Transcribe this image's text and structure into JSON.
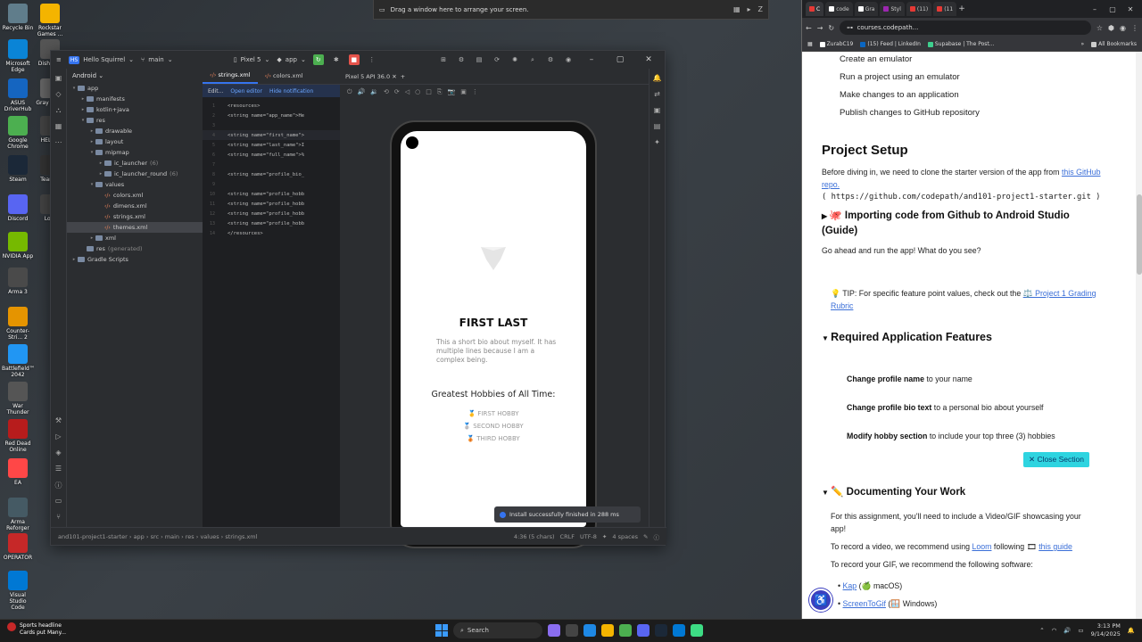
{
  "desktop": {
    "icons": [
      {
        "label": "Recycle Bin",
        "color": "#607d8b"
      },
      {
        "label": "Rockstar Games ...",
        "color": "#f4b400"
      },
      {
        "label": "Microsoft Edge",
        "color": "#0a84d6"
      },
      {
        "label": "Dishon...",
        "color": "#555555"
      },
      {
        "label": "ASUS DriverHub",
        "color": "#1565c0"
      },
      {
        "label": "Gray Wa...",
        "color": "#666666"
      },
      {
        "label": "Google Chrome",
        "color": "#4caf50"
      },
      {
        "label": "HELL...",
        "color": "#444444"
      },
      {
        "label": "Steam",
        "color": "#1b2838"
      },
      {
        "label": "Team...",
        "color": "#333333"
      },
      {
        "label": "Discord",
        "color": "#5865f2"
      },
      {
        "label": "Lo...",
        "color": "#444444"
      },
      {
        "label": "NVIDIA App",
        "color": "#76b900"
      },
      {
        "label": "Arma 3",
        "color": "#4a4a4a"
      },
      {
        "label": "Counter-Stri... 2",
        "color": "#e59400"
      },
      {
        "label": "Battlefield™ 2042",
        "color": "#2196f3"
      },
      {
        "label": "War Thunder",
        "color": "#555555"
      },
      {
        "label": "Red Dead Online",
        "color": "#b71c1c"
      },
      {
        "label": "EA",
        "color": "#ff4747"
      },
      {
        "label": "Arma Reforger",
        "color": "#455a64"
      },
      {
        "label": "OPERATOR",
        "color": "#c62828"
      },
      {
        "label": "Visual Studio Code",
        "color": "#0078d4"
      }
    ]
  },
  "snap_bar": {
    "text": "Drag a window here to arrange your screen.",
    "controls": [
      "▦",
      "▸",
      "Z"
    ]
  },
  "android_studio": {
    "project_badge": "HS",
    "project_name": "Hello Squirrel",
    "branch": "main",
    "device": "Pixel 5",
    "run_config": "app",
    "project_view": "Android",
    "tree": [
      {
        "label": "app",
        "indent": 0,
        "kind": "folder",
        "arrow": "▾"
      },
      {
        "label": "manifests",
        "indent": 1,
        "kind": "folder",
        "arrow": "▸"
      },
      {
        "label": "kotlin+java",
        "indent": 1,
        "kind": "folder",
        "arrow": "▸"
      },
      {
        "label": "res",
        "indent": 1,
        "kind": "folder",
        "arrow": "▾"
      },
      {
        "label": "drawable",
        "indent": 2,
        "kind": "folder",
        "arrow": "▸"
      },
      {
        "label": "layout",
        "indent": 2,
        "kind": "folder",
        "arrow": "▸"
      },
      {
        "label": "mipmap",
        "indent": 2,
        "kind": "folder",
        "arrow": "▾"
      },
      {
        "label": "ic_launcher",
        "indent": 3,
        "kind": "folder",
        "arrow": "▸",
        "extra": "(6)"
      },
      {
        "label": "ic_launcher_round",
        "indent": 3,
        "kind": "folder",
        "arrow": "▸",
        "extra": "(6)"
      },
      {
        "label": "values",
        "indent": 2,
        "kind": "folder",
        "arrow": "▾"
      },
      {
        "label": "colors.xml",
        "indent": 3,
        "kind": "xml",
        "arrow": ""
      },
      {
        "label": "dimens.xml",
        "indent": 3,
        "kind": "xml",
        "arrow": ""
      },
      {
        "label": "strings.xml",
        "indent": 3,
        "kind": "xml",
        "arrow": ""
      },
      {
        "label": "themes.xml",
        "indent": 3,
        "kind": "xml",
        "arrow": "",
        "selected": true
      },
      {
        "label": "xml",
        "indent": 2,
        "kind": "folder",
        "arrow": "▸"
      },
      {
        "label": "res",
        "indent": 1,
        "kind": "folder",
        "arrow": "",
        "extra": "(generated)"
      },
      {
        "label": "Gradle Scripts",
        "indent": 0,
        "kind": "folder",
        "arrow": "▸"
      }
    ],
    "editor_tabs": [
      "strings.xml",
      "colors.xml"
    ],
    "notification": {
      "left": "Edit...",
      "open": "Open editor",
      "hide": "Hide notification"
    },
    "code_lines": [
      {
        "n": "1",
        "text": "<resources>"
      },
      {
        "n": "2",
        "text": "    <string name=\"app_name\">He"
      },
      {
        "n": "3",
        "text": ""
      },
      {
        "n": "4",
        "text": "    <string name=\"first_name\">",
        "current": true
      },
      {
        "n": "5",
        "text": "    <string name=\"last_name\">I"
      },
      {
        "n": "6",
        "text": "    <string name=\"full_name\">%"
      },
      {
        "n": "7",
        "text": ""
      },
      {
        "n": "8",
        "text": "    <string name=\"profile_bio_"
      },
      {
        "n": "9",
        "text": ""
      },
      {
        "n": "10",
        "text": "    <string name=\"profile_hobb"
      },
      {
        "n": "11",
        "text": "    <string name=\"profile_hobb"
      },
      {
        "n": "12",
        "text": "    <string name=\"profile_hobb"
      },
      {
        "n": "13",
        "text": "    <string name=\"profile_hobb"
      },
      {
        "n": "14",
        "text": "</resources>"
      }
    ],
    "emulator_tab": "Pixel 5 API 36.0",
    "phone": {
      "name": "FIRST LAST",
      "bio": "This a short bio about myself. It has multiple lines because I am a complex being.",
      "hobbies_title": "Greatest Hobbies of All Time:",
      "hobbies": [
        "🥇 FIRST HOBBY",
        "🥈 SECOND HOBBY",
        "🥉 THIRD HOBBY"
      ]
    },
    "toast": "Install successfully finished in 288 ms",
    "breadcrumb": [
      "and101-project1-starter",
      "app",
      "src",
      "main",
      "res",
      "values",
      "strings.xml"
    ],
    "status_right": [
      "4:36 (5 chars)",
      "CRLF",
      "UTF-8",
      "4 spaces"
    ]
  },
  "chrome": {
    "tabs": [
      "C",
      "code",
      "Gra",
      "Styl",
      "(11)",
      "(11"
    ],
    "url": "courses.codepath...",
    "bookmarks": [
      {
        "label": "ZurabC19",
        "color": "#ffffff"
      },
      {
        "label": "(15) Feed | LinkedIn",
        "color": "#0a66c2"
      },
      {
        "label": "Supabase | The Post...",
        "color": "#3ecf8e"
      }
    ],
    "all_bookmarks": "All Bookmarks",
    "page": {
      "list_items": [
        "Create an emulator",
        "Run a project using an emulator",
        "Make changes to an application",
        "Publish changes to GitHub repository"
      ],
      "setup_title": "Project Setup",
      "setup_text": "Before diving in, we need to clone the starter version of the app from",
      "setup_link": "this GitHub repo.",
      "repo_url": "( https://github.com/codepath/and101-project1-starter.git )",
      "import_title": "🐙 Importing code from Github to Android Studio (Guide)",
      "run_question": "Go ahead and run the app! What do you see?",
      "tip_text": "💡 TIP: For specific feature point values, check out the",
      "tip_link": "⚖️ Project 1 Grading Rubric",
      "required_title": "Required Application Features",
      "features": [
        {
          "bold": "Change profile name",
          "rest": " to your name"
        },
        {
          "bold": "Change profile bio text",
          "rest": " to a personal bio about yourself"
        },
        {
          "bold": "Modify hobby section",
          "rest": " to include your top three (3) hobbies"
        }
      ],
      "close_section": "✕ Close Section",
      "doc_title": "✏️ Documenting Your Work",
      "doc_p1": "For this assignment, you'll need to include a Video/GIF showcasing your app!",
      "doc_p2_a": "To record a video, we recommend using",
      "doc_p2_loom": "Loom",
      "doc_p2_b": "following 🎞",
      "doc_p2_guide": "this guide",
      "doc_p3": "To record your GIF, we recommend the following software:",
      "software": [
        {
          "link": "Kap",
          "rest": " (🍏 macOS)"
        },
        {
          "link": "ScreenToGif",
          "rest": " (🪟 Windows)"
        }
      ]
    }
  },
  "taskbar": {
    "news_title": "Sports headline",
    "news_sub": "Cards put Many...",
    "search": "Search",
    "apps": [
      "#8a6df0",
      "#444444",
      "#1e88e5",
      "#f4b400",
      "#4caf50",
      "#5865f2",
      "#1b2838",
      "#0078d4",
      "#3ddc84"
    ],
    "time": "3:13 PM",
    "date": "9/14/2025"
  }
}
